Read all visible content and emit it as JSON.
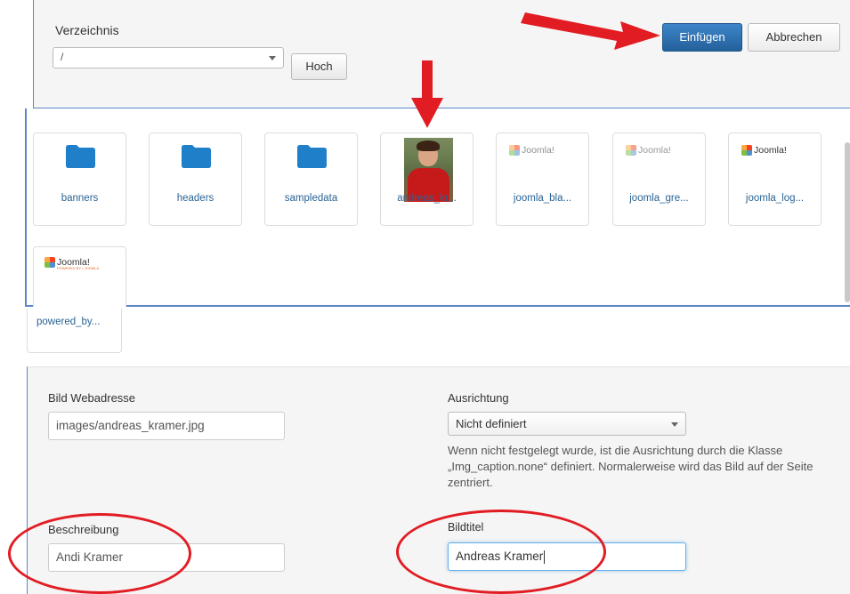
{
  "header": {
    "directory_label": "Verzeichnis",
    "directory_value": "/",
    "up_button": "Hoch",
    "insert_button": "Einfügen",
    "cancel_button": "Abbrechen"
  },
  "browser": {
    "items": [
      {
        "type": "folder",
        "label": "banners"
      },
      {
        "type": "folder",
        "label": "headers"
      },
      {
        "type": "folder",
        "label": "sampledata"
      },
      {
        "type": "image",
        "label": "andreas_kr..."
      },
      {
        "type": "image",
        "label": "joomla_bla...",
        "logo_text": "Joomla!"
      },
      {
        "type": "image",
        "label": "joomla_gre...",
        "logo_text": "Joomla!"
      },
      {
        "type": "image",
        "label": "joomla_log...",
        "logo_text": "Joomla!"
      },
      {
        "type": "image",
        "label": "powered_by...",
        "logo_text": "Joomla!",
        "logo_subtext": "POWERED BY • JOOMLA"
      }
    ]
  },
  "form": {
    "image_url_label": "Bild Webadresse",
    "image_url_value": "images/andreas_kramer.jpg",
    "alignment_label": "Ausrichtung",
    "alignment_value": "Nicht definiert",
    "alignment_help": "Wenn nicht festgelegt wurde, ist die Ausrichtung durch die Klasse „Img_caption.none“ definiert. Normalerweise wird das Bild auf der Seite zentriert.",
    "description_label": "Beschreibung",
    "description_value": "Andi Kramer",
    "title_label": "Bildtitel",
    "title_value": "Andreas Kramer"
  },
  "colors": {
    "primary": "#2f74b5",
    "folder": "#1f7fc8",
    "annotation": "#e21c23",
    "link": "#2a6496"
  },
  "icons": [
    "folder-icon",
    "joomla-logo-icon",
    "chevron-down-icon",
    "arrow-annotation"
  ]
}
